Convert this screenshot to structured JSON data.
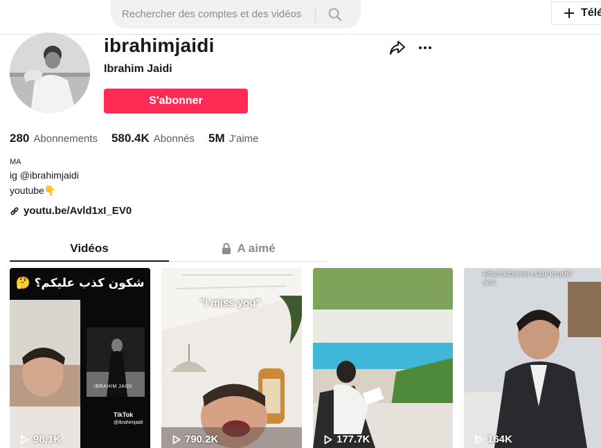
{
  "search": {
    "placeholder": "Rechercher des comptes et des vidéos"
  },
  "header": {
    "upload_label": "Télé"
  },
  "profile": {
    "username": "ibrahimjaidi",
    "nickname": "Ibrahim Jaidi",
    "follow_label": "S'abonner"
  },
  "stats": [
    {
      "value": "280",
      "label": "Abonnements"
    },
    {
      "value": "580.4K",
      "label": "Abonnés"
    },
    {
      "value": "5M",
      "label": "J'aime"
    }
  ],
  "bio": {
    "line1": "MA",
    "line2": "ig @ibrahimjaidi",
    "line3": "youtube👇"
  },
  "link": {
    "text": "youtu.be/Avld1xI_EV0"
  },
  "tabs": {
    "videos": "Vidéos",
    "liked": "A aimé"
  },
  "videos": [
    {
      "views": "98.1K",
      "caption": "🤔 شكون كذب عليكم؟",
      "inner_label": "IBRAHIM JAIDI",
      "watermark": "TikTok",
      "watermark_handle": "@ibrahimjaidi"
    },
    {
      "views": "790.2K",
      "caption": "\"i miss you\""
    },
    {
      "views": "177.7K"
    },
    {
      "views": "164K",
      "caption_line1": "kifach kit3amel m3ak lcrush?",
      "caption_line2": "ana:"
    }
  ],
  "colors": {
    "accent": "#fe2c55",
    "text": "#161823",
    "muted": "#8a8b91"
  }
}
